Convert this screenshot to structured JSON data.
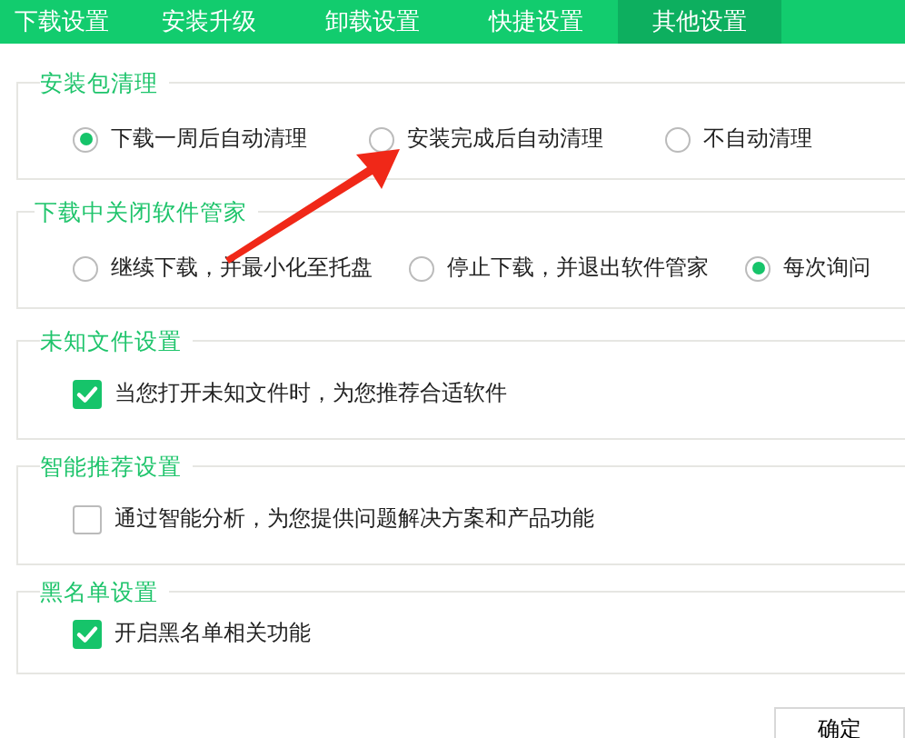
{
  "tabs": [
    {
      "label": "下载设置",
      "selected": false
    },
    {
      "label": "安装升级",
      "selected": false
    },
    {
      "label": "卸载设置",
      "selected": false
    },
    {
      "label": "快捷设置",
      "selected": false
    },
    {
      "label": "其他设置",
      "selected": true
    }
  ],
  "sections": [
    {
      "title": "安装包清理",
      "kind": "radio",
      "options": [
        {
          "label": "下载一周后自动清理",
          "selected": true
        },
        {
          "label": "安装完成后自动清理",
          "selected": false
        },
        {
          "label": "不自动清理",
          "selected": false
        }
      ]
    },
    {
      "title": "下载中关闭软件管家",
      "kind": "radio",
      "options": [
        {
          "label": "继续下载，并最小化至托盘",
          "selected": false
        },
        {
          "label": "停止下载，并退出软件管家",
          "selected": false
        },
        {
          "label": "每次询问",
          "selected": true
        }
      ]
    },
    {
      "title": "未知文件设置",
      "kind": "checkbox",
      "options": [
        {
          "label": "当您打开未知文件时，为您推荐合适软件",
          "checked": true
        }
      ]
    },
    {
      "title": "智能推荐设置",
      "kind": "checkbox",
      "options": [
        {
          "label": "通过智能分析，为您提供问题解决方案和产品功能",
          "checked": false
        }
      ]
    },
    {
      "title": "黑名单设置",
      "kind": "checkbox",
      "options": [
        {
          "label": "开启黑名单相关功能",
          "checked": true
        }
      ]
    }
  ],
  "ok_button": "确定"
}
